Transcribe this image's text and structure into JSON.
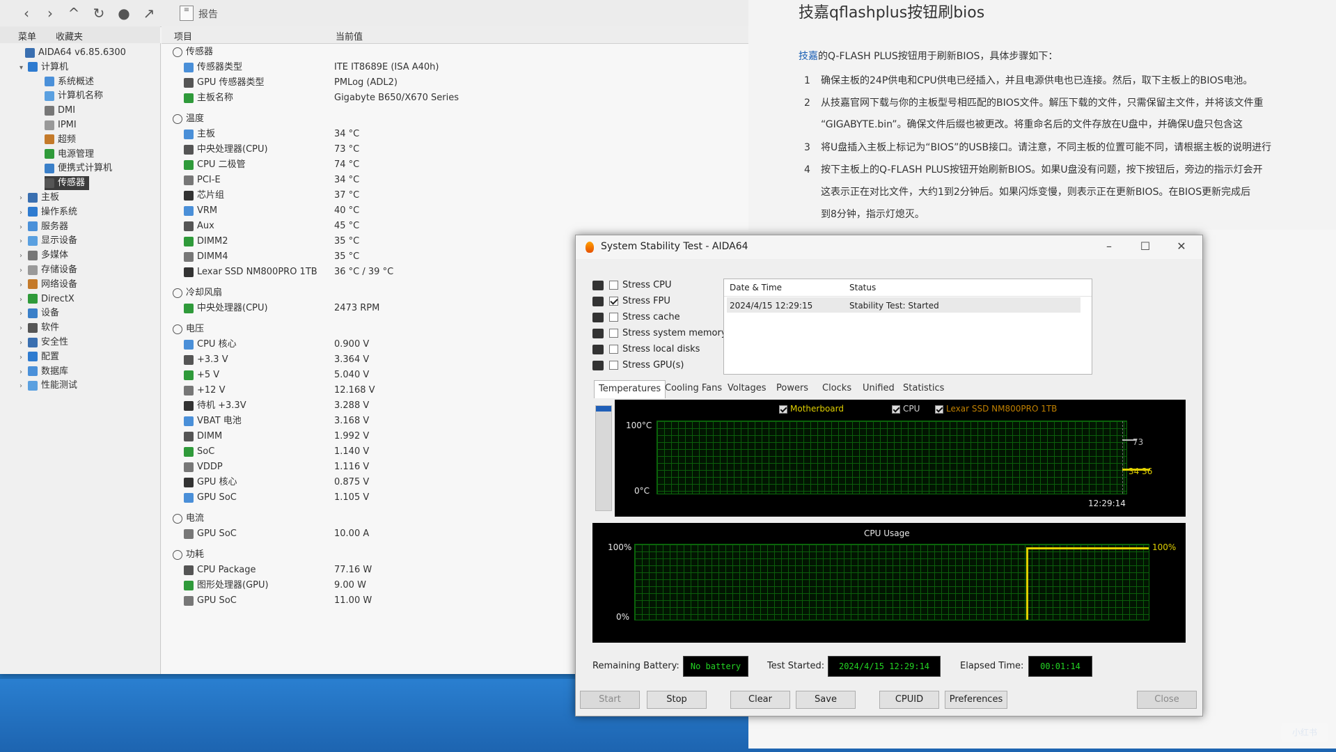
{
  "aida": {
    "report_label": "报告",
    "left_tabs": [
      "菜单",
      "收藏夹"
    ],
    "tree": [
      {
        "label": "AIDA64 v6.85.6300",
        "indent": 0
      },
      {
        "label": "计算机",
        "indent": 1
      },
      {
        "label": "系统概述",
        "indent": 2
      },
      {
        "label": "计算机名称",
        "indent": 2
      },
      {
        "label": "DMI",
        "indent": 2
      },
      {
        "label": "IPMI",
        "indent": 2
      },
      {
        "label": "超频",
        "indent": 2
      },
      {
        "label": "电源管理",
        "indent": 2
      },
      {
        "label": "便携式计算机",
        "indent": 2
      },
      {
        "label": "传感器",
        "indent": 2,
        "selected": true
      },
      {
        "label": "主板",
        "indent": 1
      },
      {
        "label": "操作系统",
        "indent": 1
      },
      {
        "label": "服务器",
        "indent": 1
      },
      {
        "label": "显示设备",
        "indent": 1
      },
      {
        "label": "多媒体",
        "indent": 1
      },
      {
        "label": "存储设备",
        "indent": 1
      },
      {
        "label": "网络设备",
        "indent": 1
      },
      {
        "label": "DirectX",
        "indent": 1
      },
      {
        "label": "设备",
        "indent": 1
      },
      {
        "label": "软件",
        "indent": 1
      },
      {
        "label": "安全性",
        "indent": 1
      },
      {
        "label": "配置",
        "indent": 1
      },
      {
        "label": "数据库",
        "indent": 1
      },
      {
        "label": "性能测试",
        "indent": 1
      }
    ],
    "columns": {
      "item": "项目",
      "value": "当前值"
    },
    "rows": [
      {
        "type": "section",
        "label": "传感器"
      },
      {
        "label": "传感器类型",
        "value": "ITE IT8689E  (ISA A40h)"
      },
      {
        "label": "GPU 传感器类型",
        "value": "PMLog  (ADL2)"
      },
      {
        "label": "主板名称",
        "value": "Gigabyte B650/X670 Series"
      },
      {
        "type": "gap"
      },
      {
        "type": "section",
        "label": "温度"
      },
      {
        "label": "主板",
        "value": "34 °C"
      },
      {
        "label": "中央处理器(CPU)",
        "value": "73 °C"
      },
      {
        "label": "CPU 二极管",
        "value": "74 °C"
      },
      {
        "label": "PCI-E",
        "value": "34 °C"
      },
      {
        "label": "芯片组",
        "value": "37 °C"
      },
      {
        "label": "VRM",
        "value": "40 °C"
      },
      {
        "label": "Aux",
        "value": "45 °C"
      },
      {
        "label": "DIMM2",
        "value": "35 °C"
      },
      {
        "label": "DIMM4",
        "value": "35 °C"
      },
      {
        "label": "Lexar SSD NM800PRO 1TB",
        "value": "36 °C / 39 °C"
      },
      {
        "type": "gap"
      },
      {
        "type": "section",
        "label": "冷却风扇"
      },
      {
        "label": "中央处理器(CPU)",
        "value": "2473 RPM"
      },
      {
        "type": "gap"
      },
      {
        "type": "section",
        "label": "电压"
      },
      {
        "label": "CPU 核心",
        "value": "0.900 V"
      },
      {
        "label": "+3.3 V",
        "value": "3.364 V"
      },
      {
        "label": "+5 V",
        "value": "5.040 V"
      },
      {
        "label": "+12 V",
        "value": "12.168 V"
      },
      {
        "label": "待机 +3.3V",
        "value": "3.288 V"
      },
      {
        "label": "VBAT 电池",
        "value": "3.168 V"
      },
      {
        "label": "DIMM",
        "value": "1.992 V"
      },
      {
        "label": "SoC",
        "value": "1.140 V"
      },
      {
        "label": "VDDP",
        "value": "1.116 V"
      },
      {
        "label": "GPU 核心",
        "value": "0.875 V"
      },
      {
        "label": "GPU SoC",
        "value": "1.105 V"
      },
      {
        "type": "gap"
      },
      {
        "type": "section",
        "label": "电流"
      },
      {
        "label": "GPU SoC",
        "value": "10.00 A"
      },
      {
        "type": "gap"
      },
      {
        "type": "section",
        "label": "功耗"
      },
      {
        "label": "CPU Package",
        "value": "77.16 W"
      },
      {
        "label": "图形处理器(GPU)",
        "value": "9.00 W"
      },
      {
        "label": "GPU SoC",
        "value": "11.00 W"
      }
    ]
  },
  "article": {
    "title": "技嘉qflashplus按钮刷bios",
    "intro_brand": "技嘉",
    "intro_rest": "的Q-FLASH PLUS按钮用于刷新BIOS，具体步骤如下：",
    "steps": [
      {
        "n": "1",
        "text": "确保主板的24P供电和CPU供电已经插入，并且电源供电也已连接。然后，取下主板上的BIOS电池。"
      },
      {
        "n": "2",
        "text": "从技嘉官网下载与你的主板型号相匹配的BIOS文件。解压下载的文件，只需保留主文件，并将该文件重"
      },
      {
        "n": "",
        "text": "“GIGABYTE.bin”。确保文件后缀也被更改。将重命名后的文件存放在U盘中，并确保U盘只包含这"
      },
      {
        "n": "3",
        "text": "将U盘插入主板上标记为“BIOS”的USB接口。请注意，不同主板的位置可能不同，请根据主板的说明进行"
      },
      {
        "n": "4",
        "text": "按下主板上的Q-FLASH PLUS按钮开始刷新BIOS。如果U盘没有问题，按下按钮后，旁边的指示灯会开"
      },
      {
        "n": "",
        "text": "这表示正在对比文件，大约1到2分钟后。如果闪烁变慢，则表示正在更新BIOS。在BIOS更新完成后"
      },
      {
        "n": "",
        "text": "到8分钟，指示灯熄灭。"
      }
    ]
  },
  "sst": {
    "title": "System Stability Test - AIDA64",
    "stress": [
      {
        "label": "Stress CPU",
        "checked": false
      },
      {
        "label": "Stress FPU",
        "checked": true
      },
      {
        "label": "Stress cache",
        "checked": false
      },
      {
        "label": "Stress system memory",
        "checked": false
      },
      {
        "label": "Stress local disks",
        "checked": false
      },
      {
        "label": "Stress GPU(s)",
        "checked": false
      }
    ],
    "log": {
      "col_datetime": "Date & Time",
      "col_status": "Status",
      "entry_datetime": "2024/4/15 12:29:15",
      "entry_status": "Stability Test: Started"
    },
    "tabs": [
      "Temperatures",
      "Cooling Fans",
      "Voltages",
      "Powers",
      "Clocks",
      "Unified",
      "Statistics"
    ],
    "temp_graph": {
      "legend": [
        "Motherboard",
        "CPU",
        "Lexar SSD NM800PRO 1TB"
      ],
      "legend_colors": [
        "#e0d000",
        "#d0d0d0",
        "#c08000"
      ],
      "y_top": "100°C",
      "y_bottom": "0°C",
      "time": "12:29:14",
      "val_cpu": "73",
      "val_mb_ssd": "34 36"
    },
    "cpu_graph": {
      "title": "CPU Usage",
      "y_top": "100%",
      "y_bottom": "0%",
      "val": "100%"
    },
    "status": {
      "battery_label": "Remaining Battery:",
      "battery_value": "No battery",
      "started_label": "Test Started:",
      "started_value": "2024/4/15 12:29:14",
      "elapsed_label": "Elapsed Time:",
      "elapsed_value": "00:01:14"
    },
    "buttons": {
      "start": "Start",
      "stop": "Stop",
      "clear": "Clear",
      "save": "Save",
      "cpuid": "CPUID",
      "preferences": "Preferences",
      "close": "Close"
    }
  },
  "watermark": "小红书"
}
